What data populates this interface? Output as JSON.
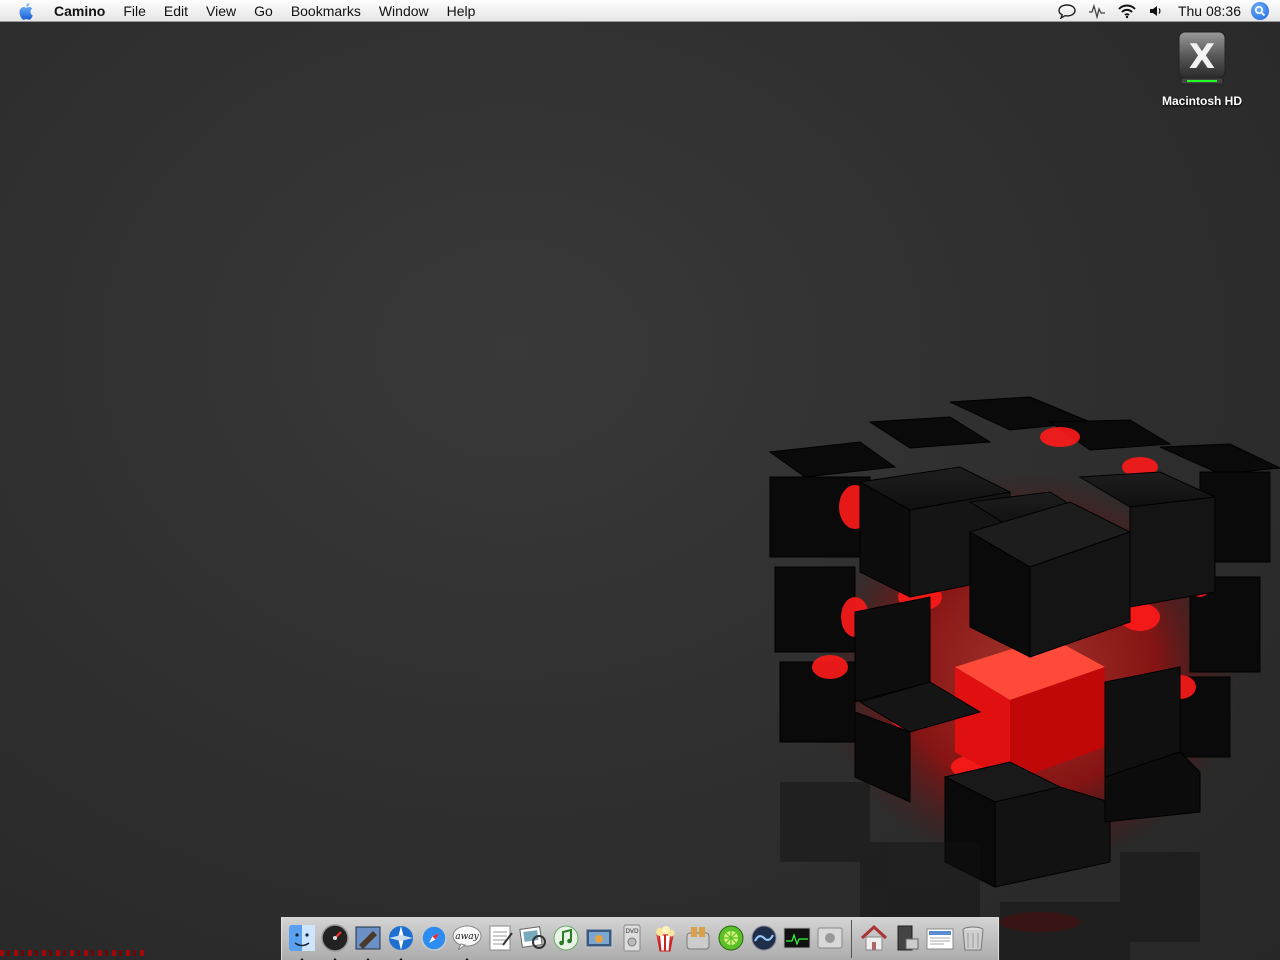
{
  "menubar": {
    "app_name": "Camino",
    "menus": [
      "File",
      "Edit",
      "View",
      "Go",
      "Bookmarks",
      "Window",
      "Help"
    ],
    "clock": "Thu 08:36",
    "status_icons": [
      "chat-bubble-icon",
      "bluetooth-signal-icon",
      "wifi-icon",
      "volume-icon"
    ]
  },
  "desktop": {
    "icons": [
      {
        "label": "Macintosh HD",
        "icon": "hard-drive-icon"
      }
    ]
  },
  "dock": {
    "apps": [
      {
        "icon": "finder-icon",
        "running": true
      },
      {
        "icon": "dashboard-icon",
        "running": true
      },
      {
        "icon": "mail-icon",
        "running": true
      },
      {
        "icon": "camino-icon",
        "running": true
      },
      {
        "icon": "safari-icon",
        "running": false
      },
      {
        "icon": "adium-away-icon",
        "running": true,
        "text": "away"
      },
      {
        "icon": "textedit-icon",
        "running": false
      },
      {
        "icon": "preview-icon",
        "running": false
      },
      {
        "icon": "itunes-icon",
        "running": false
      },
      {
        "icon": "iphoto-icon",
        "running": false
      },
      {
        "icon": "dvd-player-icon",
        "running": false
      },
      {
        "icon": "popcorn-icon",
        "running": false
      },
      {
        "icon": "toast-icon",
        "running": false
      },
      {
        "icon": "limewire-icon",
        "running": false
      },
      {
        "icon": "wave-icon",
        "running": false
      },
      {
        "icon": "activity-monitor-icon",
        "running": false
      },
      {
        "icon": "system-preferences-icon",
        "running": false
      }
    ],
    "others": [
      {
        "icon": "home-folder-icon"
      },
      {
        "icon": "applications-folder-icon"
      },
      {
        "icon": "documents-stack-icon"
      },
      {
        "icon": "trash-icon"
      }
    ]
  },
  "colors": {
    "desktop": "#303030",
    "cube_glow": "#ff1a1a",
    "menubar": "#f2f2f2"
  }
}
